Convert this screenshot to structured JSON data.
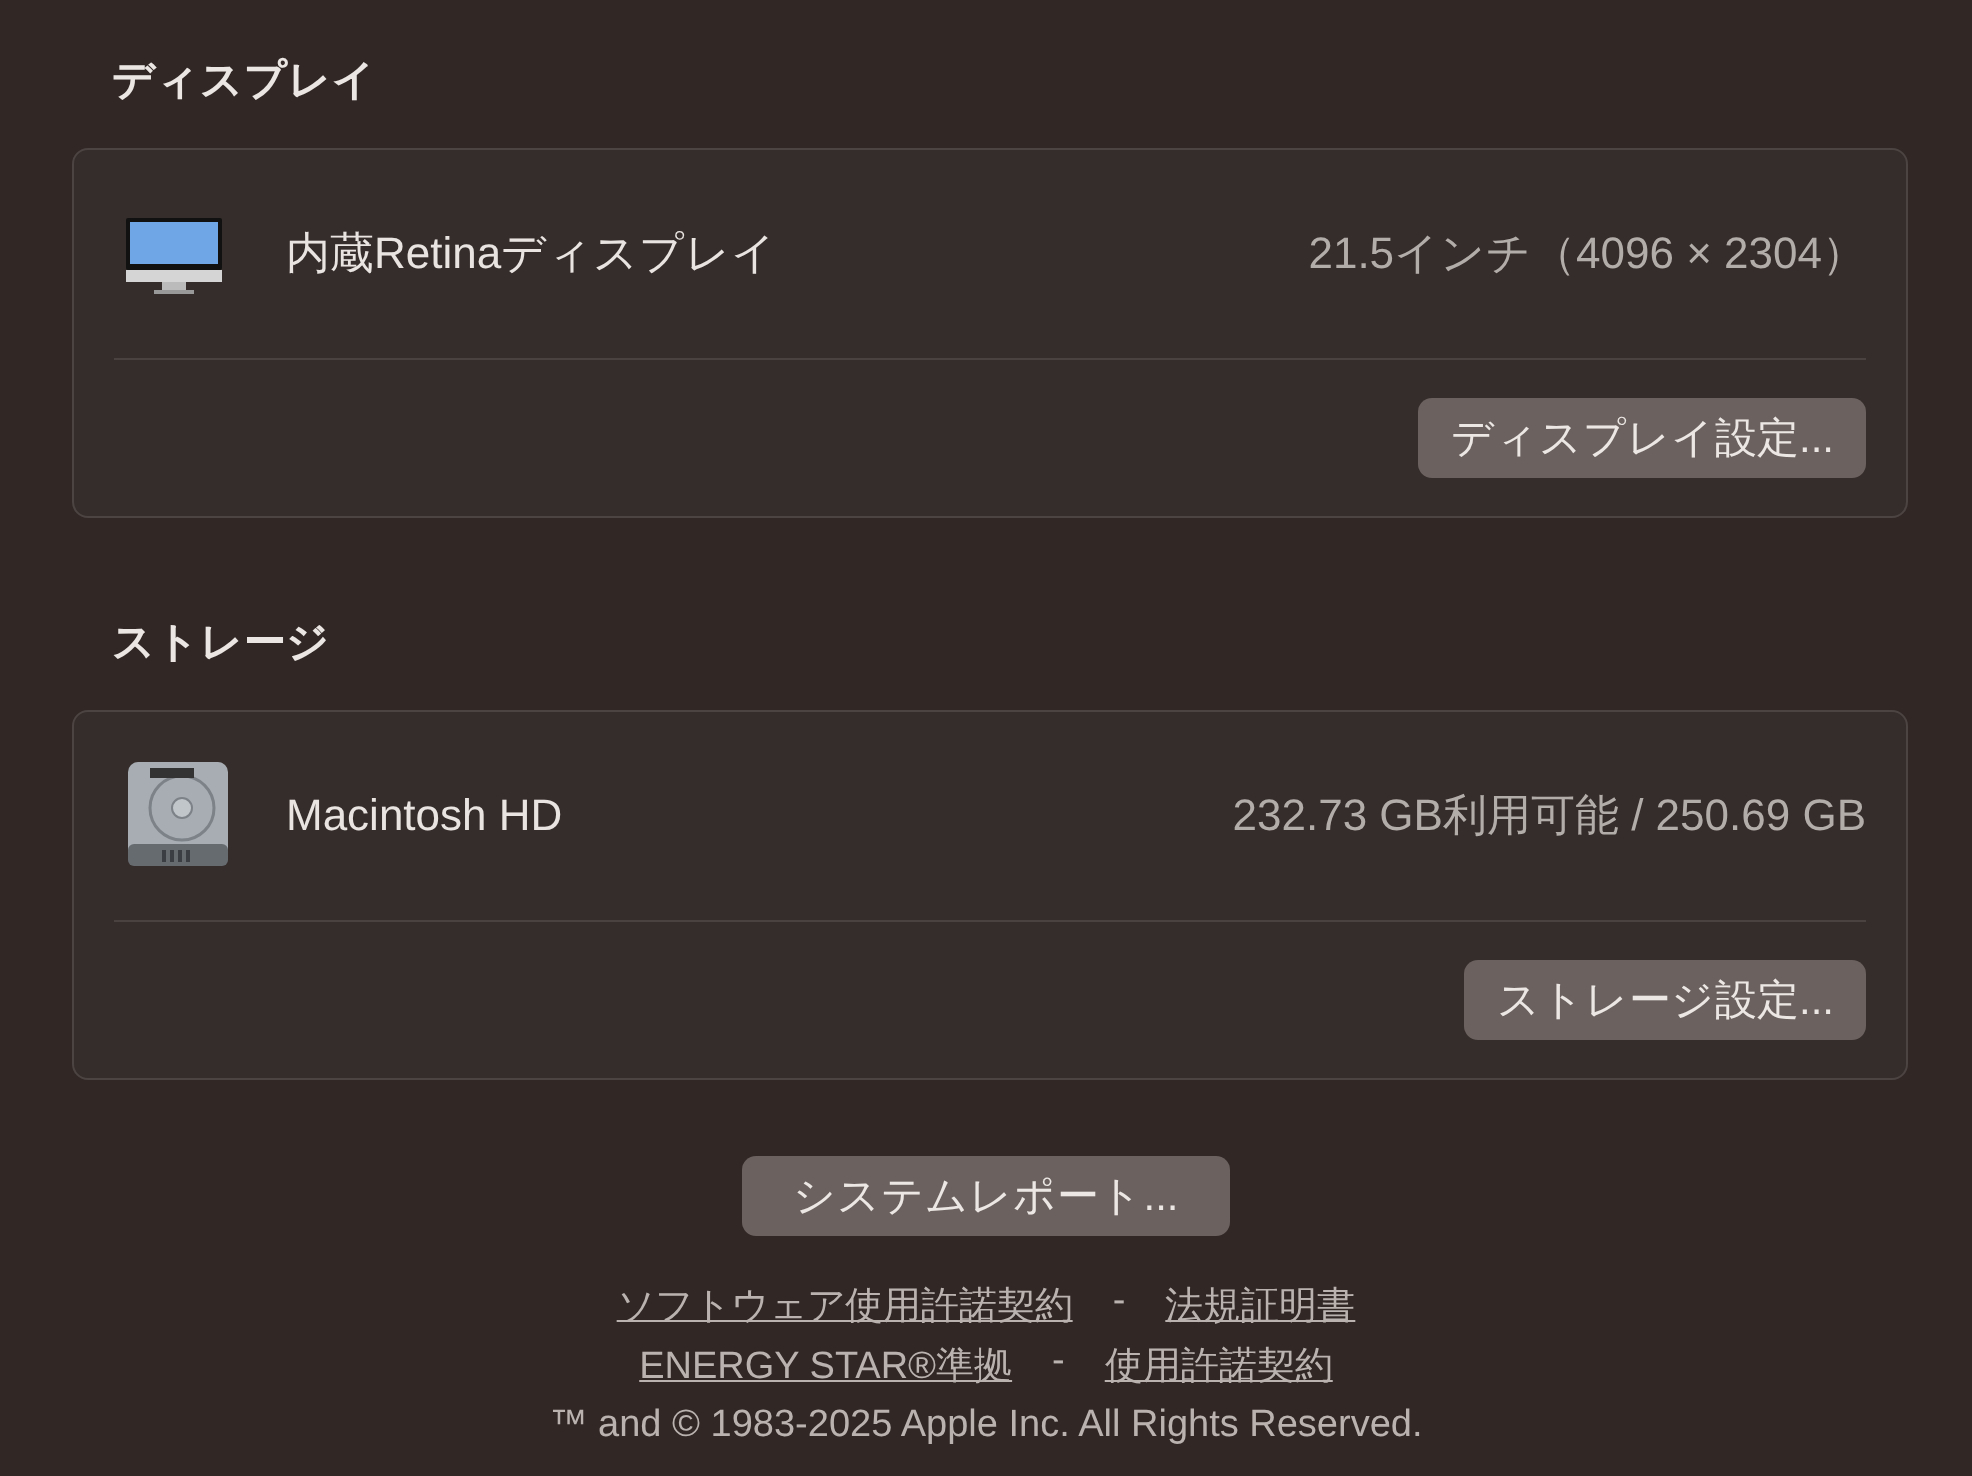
{
  "sections": [
    {
      "title": "ディスプレイ",
      "kind": "display",
      "name": "内蔵Retinaディスプレイ",
      "detail": "21.5インチ（4096 × 2304）",
      "button": "ディスプレイ設定..."
    },
    {
      "title": "ストレージ",
      "kind": "storage",
      "name": "Macintosh HD",
      "detail": "232.73 GB利用可能 / 250.69 GB",
      "button": "ストレージ設定..."
    }
  ],
  "report_button": "システムレポート...",
  "links": [
    [
      "ソフトウェア使用許諾契約",
      "-",
      "法規証明書"
    ],
    [
      "ENERGY STAR®準拠",
      "-",
      "使用許諾契約"
    ]
  ],
  "copyright": "™ and © 1983-2025 Apple Inc. All Rights Reserved."
}
